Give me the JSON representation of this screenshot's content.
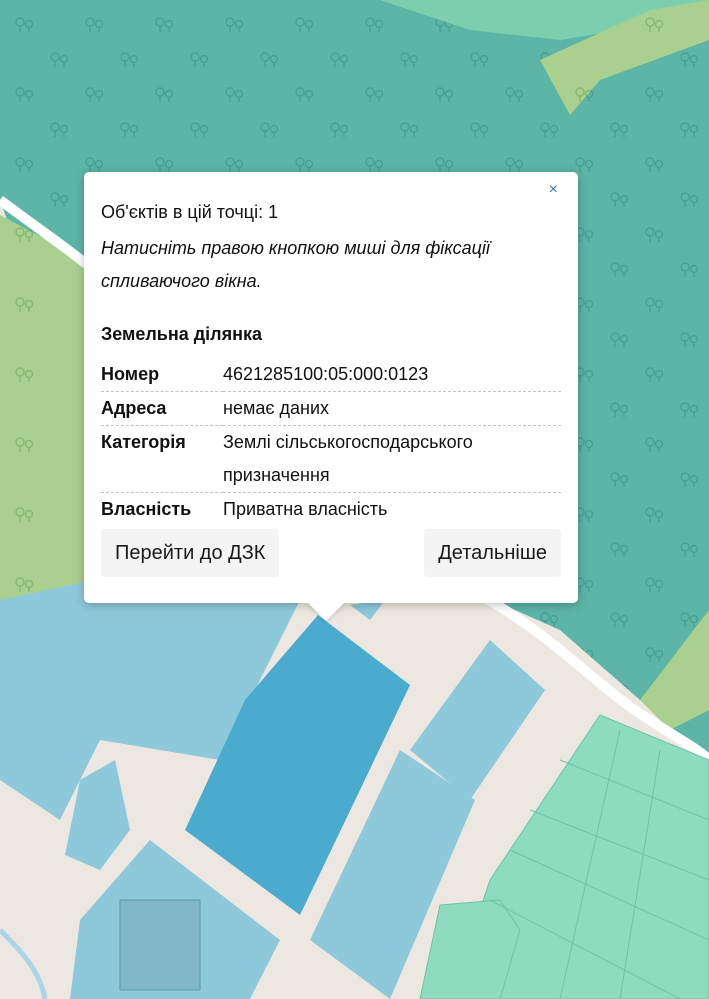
{
  "map": {
    "colors": {
      "background": "#ece8e1",
      "forest": "#5cb5a6",
      "forest_light": "#7ccfae",
      "grass": "#a9d08e",
      "parcel": "#8ec8db",
      "parcel_selected": "#4aabcf",
      "parcel_green": "#8ddcbf",
      "road": "#ffffff",
      "water": "#a9d6e8"
    },
    "tree_icon": "tree-icon"
  },
  "popup": {
    "close_label": "×",
    "count_line": "Об'єктів в цій точці: 1",
    "hint": "Натисніть правою кнопкою миші для фіксації спливаючого вікна.",
    "section_title": "Земельна ділянка",
    "rows": [
      {
        "key": "Номер",
        "value": "4621285100:05:000:0123"
      },
      {
        "key": "Адреса",
        "value": "немає даних"
      },
      {
        "key": "Категорія",
        "value": "Землі сільськогосподарського призначення"
      },
      {
        "key": "Власність",
        "value": "Приватна власність"
      }
    ],
    "buttons": {
      "dzk": "Перейти до ДЗК",
      "details": "Детальніше"
    }
  }
}
